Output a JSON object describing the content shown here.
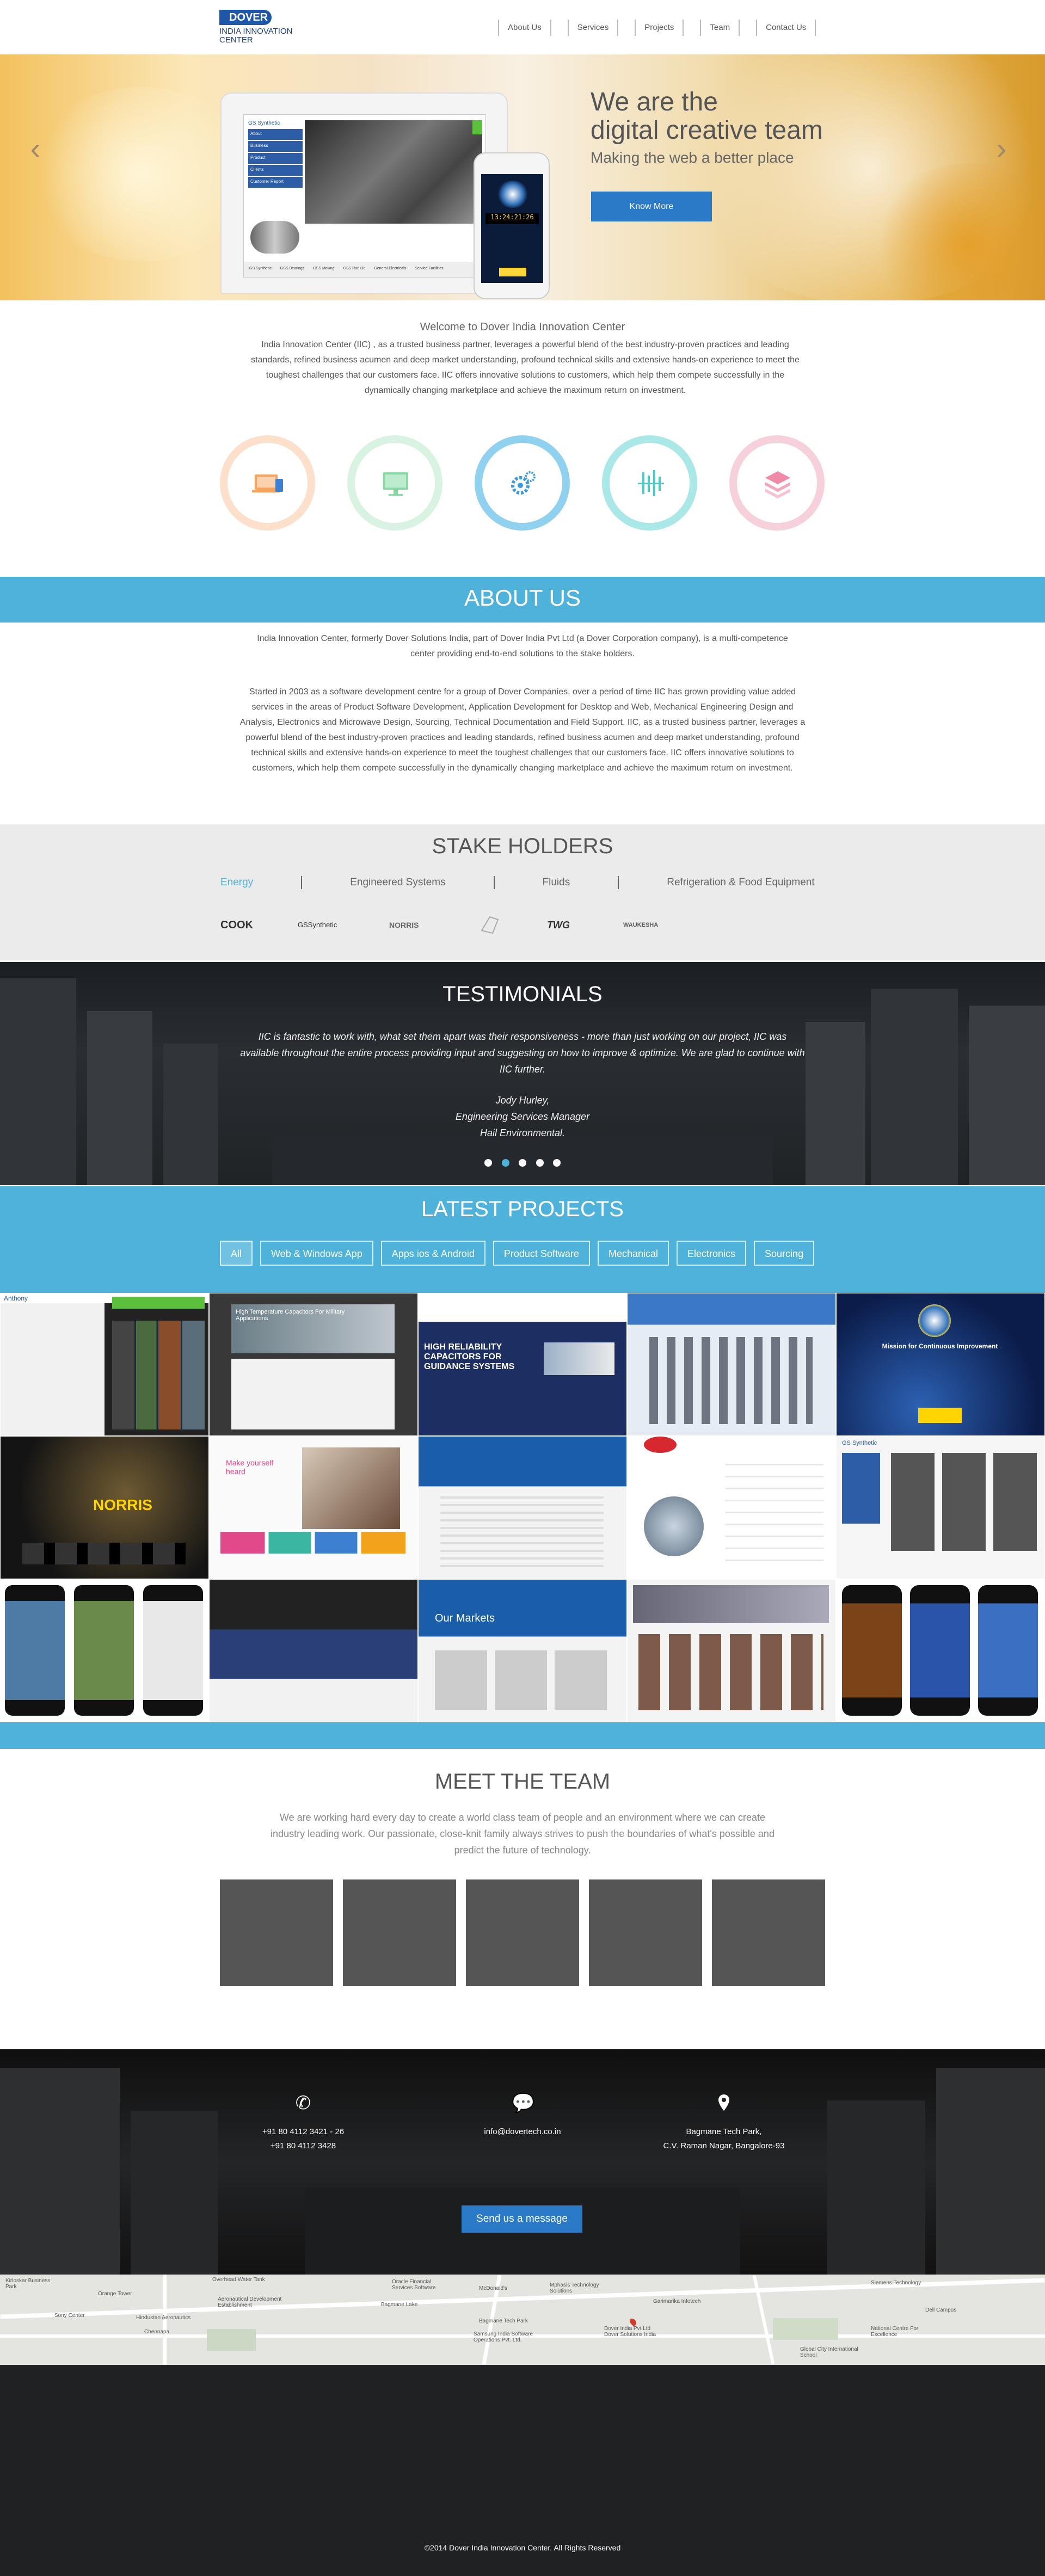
{
  "header": {
    "logo_mark": "DOVER",
    "logo_text": "INDIA INNOVATION CENTER",
    "nav": [
      "About Us",
      "Services",
      "Projects",
      "Team",
      "Contact Us"
    ]
  },
  "hero": {
    "title_line1": "We are the",
    "title_line2": "digital creative team",
    "subtitle": "Making the web a better place",
    "button": "Know More",
    "prev_icon": "chevron-left-icon",
    "next_icon": "chevron-right-icon",
    "laptop_brand": "GS Synthetic",
    "laptop_menu": [
      "About",
      "Business",
      "Product",
      "Clients",
      "Customer Report"
    ],
    "laptop_tabs": [
      "GS Synthetic",
      "GSS Bearings",
      "GSS Moving",
      "GSS Run On",
      "General Electricals",
      "Service Facilities"
    ],
    "phone_clock": "13:24:21:26"
  },
  "welcome": {
    "title": "Welcome to Dover India Innovation Center",
    "text": "India Innovation Center (IIC) , as a trusted business partner, leverages a powerful blend of the best industry-proven practices and leading standards, refined business acumen and deep market understanding, profound technical skills and extensive hands-on experience to meet the toughest challenges that our customers face. IIC offers innovative solutions to customers, which help them compete successfully in the dynamically changing marketplace and achieve the maximum return on investment.",
    "service_icons": [
      "laptop-icon",
      "monitor-icon",
      "gear-icon",
      "circuit-icon",
      "layers-icon"
    ]
  },
  "about": {
    "title": "ABOUT US",
    "p1": "India Innovation Center, formerly Dover Solutions India, part of Dover India Pvt Ltd (a Dover Corporation company), is a multi-competence center providing end-to-end solutions to the stake holders.",
    "p2": "Started in 2003 as a software development centre for a group of Dover Companies, over a period of time IIC has grown providing value added services in the areas of Product Software Development, Application Development for Desktop and Web, Mechanical Engineering Design and Analysis, Electronics and Microwave Design, Sourcing, Technical Documentation and Field Support. IIC, as a trusted business partner, leverages a powerful blend of the best industry-proven practices and leading standards, refined business acumen and deep market understanding, profound technical skills and extensive hands-on experience to meet the toughest challenges that our customers face. IIC offers innovative solutions to customers, which help them compete successfully in the dynamically changing marketplace and achieve the maximum return on investment."
  },
  "stakeholders": {
    "title": "STAKE HOLDERS",
    "tabs": [
      "Energy",
      "Engineered Systems",
      "Fluids",
      "Refrigeration & Food Equipment"
    ],
    "logos": [
      "COOK",
      "GSSynthetic",
      "NORRIS",
      "TWG",
      "WAUKESHA"
    ]
  },
  "testimonials": {
    "title": "TESTIMONIALS",
    "quote": "IIC is fantastic to work with, what set them apart was their responsiveness - more than just working on our project, IIC was available throughout the entire process providing input and suggesting on how to improve & optimize. We are glad to continue with IIC further.",
    "author": "Jody Hurley,",
    "role": "Engineering Services Manager",
    "company": "Hail Environmental."
  },
  "projects": {
    "title": "LATEST PROJECTS",
    "filters": [
      "All",
      "Web & Windows App",
      "Apps ios & Android",
      "Product Software",
      "Mechanical",
      "Electronics",
      "Sourcing"
    ],
    "tiles": [
      {
        "label": "Anthony",
        "caption": ""
      },
      {
        "label": "",
        "caption": "High Temperature Capacitors For Military Applications"
      },
      {
        "label": "",
        "caption": "HIGH RELIABILITY CAPACITORS FOR GUIDANCE SYSTEMS"
      },
      {
        "label": "",
        "caption": ""
      },
      {
        "label": "",
        "caption": "Mission for Continuous Improvement"
      },
      {
        "label": "",
        "caption": "NORRIS"
      },
      {
        "label": "",
        "caption": "Make yourself heard"
      },
      {
        "label": "",
        "caption": ""
      },
      {
        "label": "",
        "caption": ""
      },
      {
        "label": "",
        "caption": "GS Synthetic"
      },
      {
        "label": "",
        "caption": ""
      },
      {
        "label": "",
        "caption": ""
      },
      {
        "label": "",
        "caption": "Our Markets"
      },
      {
        "label": "",
        "caption": ""
      },
      {
        "label": "",
        "caption": ""
      }
    ]
  },
  "team": {
    "title": "MEET THE TEAM",
    "text": "We are working hard every day to create a world class team of people and an environment where we can create industry leading work. Our passionate, close-knit family always strives to push the boundaries of what's possible and predict the future of technology."
  },
  "contact": {
    "phone_icon": "phone-icon",
    "chat_icon": "chat-icon",
    "location_icon": "location-pin-icon",
    "phone1": "+91 80 4112 3421 - 26",
    "phone2": "+91 80 4112 3428",
    "email": "info@dovertech.co.in",
    "addr1": "Bagmane Tech Park,",
    "addr2": "C.V. Raman Nagar, Bangalore-93",
    "button": "Send us a message"
  },
  "map": {
    "labels": [
      "Kirloskar Business Park",
      "Orange Tower",
      "Overhead Water Tank",
      "Oracle Financial Services Software",
      "McDonald's",
      "Mphasis Technology Solutions",
      "Aeronautical Development Establishment",
      "Bagmane Lake",
      "Garimarika Infotech",
      "Siemens Technology",
      "Dell Campus",
      "Sony Center",
      "Hindustan Aeronautics",
      "Chennapa",
      "Dover India Pvt Ltd Dover Solutions India",
      "National Centre For Excellence",
      "Global City International School",
      "Bagmane Tech Park",
      "Samsung India Software Operations Pvt. Ltd."
    ]
  },
  "footer": {
    "copyright": "©2014 Dover India Innovation Center. All Rights Reserved"
  }
}
